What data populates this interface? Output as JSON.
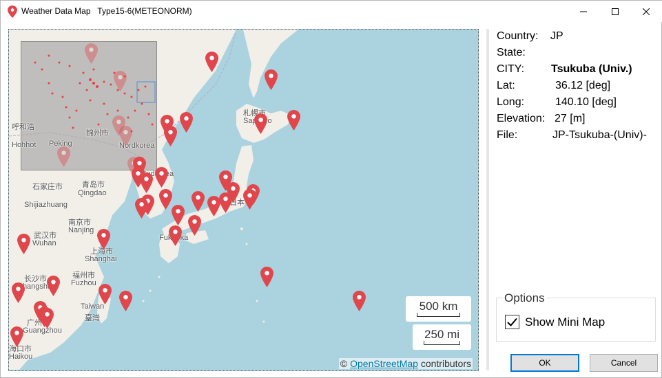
{
  "window": {
    "app_title": "Weather Data Map",
    "subtitle": "Type15-6(METEONORM)",
    "icons": {
      "app": "map-pin-icon",
      "minimize": "minimize-icon",
      "maximize": "maximize-icon",
      "close": "close-icon"
    }
  },
  "map": {
    "labels": [
      "呼和浩",
      "Hohhot",
      "Peking",
      "锦州市",
      "Nordkorea",
      "石家庄市",
      "Shijiazhuang",
      "青岛市",
      "Qingdao",
      "南京市",
      "Nanjing",
      "武汉市",
      "Wuhan",
      "上海市",
      "Shanghai",
      "长沙市",
      "Changsha",
      "福州市",
      "Fuzhou",
      "Taiwan",
      "臺灣",
      "广州市",
      "Guangzhou",
      "海口市",
      "Haikou",
      "札幌市",
      "Sapporo",
      "Fukuoka",
      "Sudkorea",
      "日本"
    ],
    "scale_km": "500 km",
    "scale_mi": "250 mi",
    "attribution_prefix": "©",
    "attribution_link": "OpenStreetMap",
    "attribution_suffix": "contributors",
    "pin_color": "#e0474c"
  },
  "info": {
    "country_label": "Country:",
    "country_value": "JP",
    "state_label": "State:",
    "state_value": "",
    "city_label": "CITY:",
    "city_value": "Tsukuba (Univ.)",
    "lat_label": "Lat:",
    "lat_value": "36.12 [deg]",
    "long_label": "Long:",
    "long_value": "140.10 [deg]",
    "elev_label": "Elevation:",
    "elev_value": "27 [m]",
    "file_label": "File:",
    "file_value": "JP-Tsukuba-(Univ)-"
  },
  "options": {
    "legend": "Options",
    "show_minimap_label": "Show Mini Map",
    "show_minimap_checked": true
  },
  "buttons": {
    "ok": "OK",
    "cancel": "Cancel"
  }
}
